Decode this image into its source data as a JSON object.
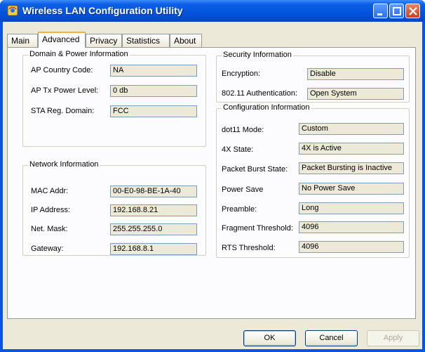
{
  "window": {
    "title": "Wireless LAN Configuration Utility"
  },
  "tabs": [
    {
      "label": "Main"
    },
    {
      "label": "Advanced"
    },
    {
      "label": "Privacy"
    },
    {
      "label": "Statistics"
    },
    {
      "label": "About"
    }
  ],
  "active_tab": "Advanced",
  "domain_power": {
    "title": "Domain & Power Information",
    "country_label": "AP Country Code:",
    "country_value": "NA",
    "power_label": "AP Tx Power Level:",
    "power_value": "0 db",
    "sta_label": "STA Reg. Domain:",
    "sta_value": "FCC"
  },
  "network": {
    "title": "Network Information",
    "mac_label": "MAC Addr:",
    "mac_value": "00-E0-98-BE-1A-40",
    "ip_label": "IP Address:",
    "ip_value": "192.168.8.21",
    "mask_label": "Net. Mask:",
    "mask_value": "255.255.255.0",
    "gateway_label": "Gateway:",
    "gateway_value": "192.168.8.1"
  },
  "security": {
    "title": "Security Information",
    "encryption_label": "Encryption:",
    "encryption_value": "Disable",
    "auth_label": "802.11 Authentication:",
    "auth_value": "Open System"
  },
  "config": {
    "title": "Configuration Information",
    "mode_label": "dot11 Mode:",
    "mode_value": "Custom",
    "state4x_label": "4X State:",
    "state4x_value": "4X is Active",
    "burst_label": "Packet Burst State:",
    "burst_value": "Packet Bursting is Inactive",
    "powersave_label": "Power Save",
    "powersave_value": "No Power Save",
    "preamble_label": "Preamble:",
    "preamble_value": "Long",
    "frag_label": "Fragment Threshold:",
    "frag_value": "4096",
    "rts_label": "RTS Threshold:",
    "rts_value": "4096"
  },
  "buttons": {
    "ok": "OK",
    "cancel": "Cancel",
    "apply": "Apply"
  },
  "colors": {
    "titlebar": "#0553dc",
    "panel": "#fcfcfe",
    "dialog": "#ece9d8"
  }
}
